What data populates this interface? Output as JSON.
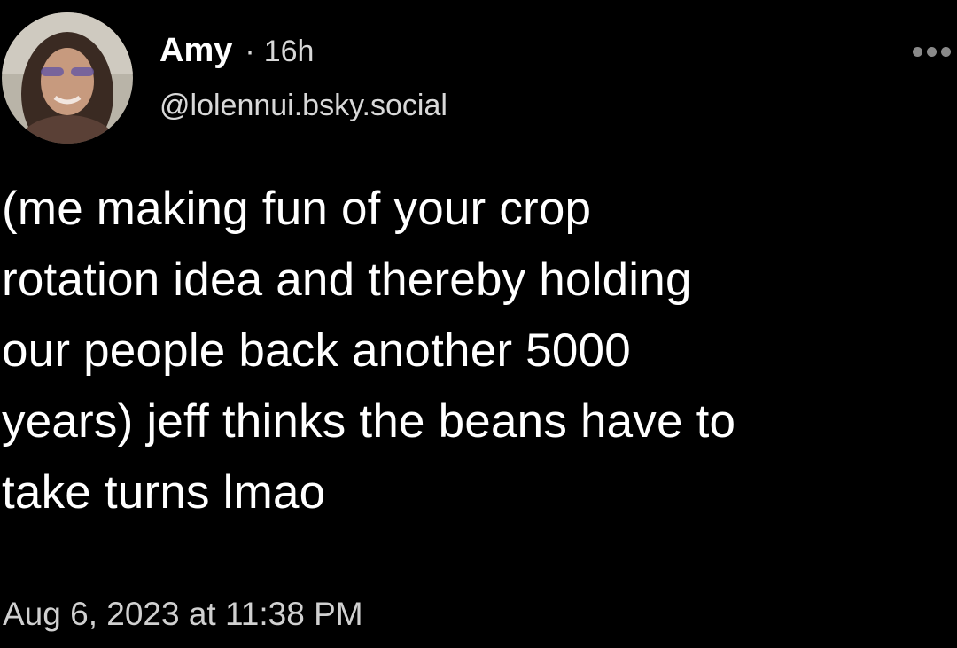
{
  "post": {
    "author": {
      "display_name": "Amy",
      "handle": "@lolennui.bsky.social",
      "avatar_icon": "user-avatar-photo"
    },
    "separator": "·",
    "time_ago": "16h",
    "menu_icon": "more-options-icon",
    "text_lines": [
      "(me making fun of your crop",
      "rotation idea and thereby holding",
      "our people back another 5000",
      "years) jeff thinks the beans have to",
      "take turns lmao"
    ],
    "timestamp": "Aug 6, 2023 at 11:38 PM"
  },
  "colors": {
    "background": "#000000",
    "primary_text": "#ffffff",
    "secondary_text": "#d8d8d8",
    "icon": "#8a8a8a"
  }
}
